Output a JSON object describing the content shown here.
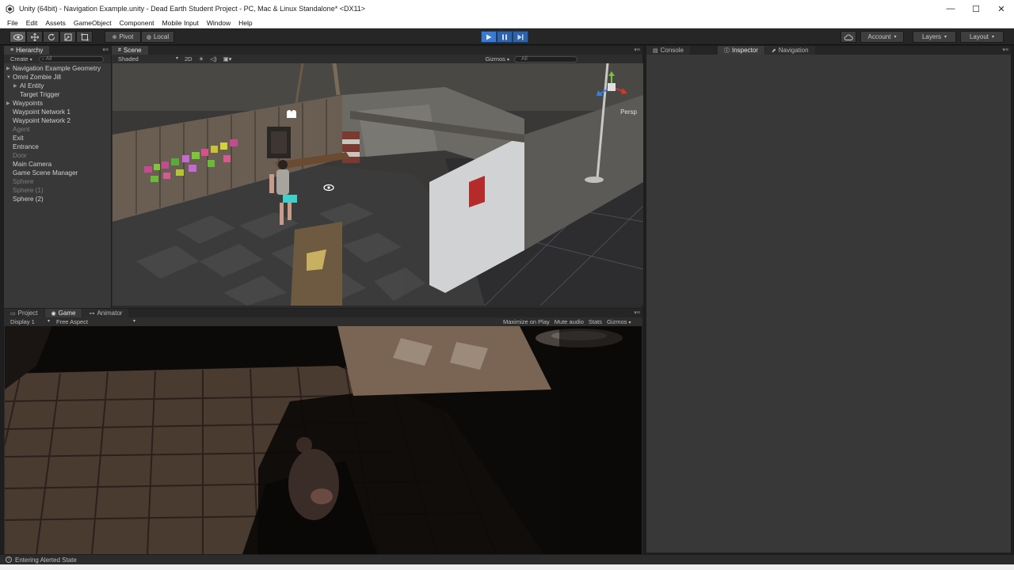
{
  "window": {
    "title": "Unity (64bit) - Navigation Example.unity - Dead Earth Student Project - PC, Mac & Linux Standalone* <DX11>",
    "minimize": "—",
    "maximize": "☐",
    "close": "✕"
  },
  "menu": [
    "File",
    "Edit",
    "Assets",
    "GameObject",
    "Component",
    "Mobile Input",
    "Window",
    "Help"
  ],
  "toolbar": {
    "pivot": "Pivot",
    "local": "Local",
    "account": "Account",
    "layers": "Layers",
    "layout": "Layout"
  },
  "hierarchy": {
    "tab": "Hierarchy",
    "create": "Create",
    "search_placeholder": "All",
    "items": [
      {
        "label": "Navigation Example Geometry",
        "indent": 0,
        "arrow": true,
        "dim": false
      },
      {
        "label": "Omni Zombie Jill",
        "indent": 0,
        "arrow": true,
        "expanded": true,
        "dim": false
      },
      {
        "label": "AI Entity",
        "indent": 1,
        "arrow": true,
        "dim": false
      },
      {
        "label": "Target Trigger",
        "indent": 1,
        "arrow": false,
        "dim": false
      },
      {
        "label": "Waypoints",
        "indent": 0,
        "arrow": true,
        "dim": false
      },
      {
        "label": "Waypoint Network 1",
        "indent": 0,
        "arrow": false,
        "dim": false
      },
      {
        "label": "Waypoint Network 2",
        "indent": 0,
        "arrow": false,
        "dim": false
      },
      {
        "label": "Agent",
        "indent": 0,
        "arrow": false,
        "dim": true
      },
      {
        "label": "Exit",
        "indent": 0,
        "arrow": false,
        "dim": false
      },
      {
        "label": "Entrance",
        "indent": 0,
        "arrow": false,
        "dim": false
      },
      {
        "label": "Door",
        "indent": 0,
        "arrow": false,
        "dim": true
      },
      {
        "label": "Main Camera",
        "indent": 0,
        "arrow": false,
        "dim": false
      },
      {
        "label": "Game Scene Manager",
        "indent": 0,
        "arrow": false,
        "dim": false
      },
      {
        "label": "Sphere",
        "indent": 0,
        "arrow": false,
        "dim": true
      },
      {
        "label": "Sphere (1)",
        "indent": 0,
        "arrow": false,
        "dim": true
      },
      {
        "label": "Sphere (2)",
        "indent": 0,
        "arrow": false,
        "dim": false
      }
    ]
  },
  "scene": {
    "tab": "Scene",
    "shading": "Shaded",
    "mode2d": "2D",
    "gizmos": "Gizmos",
    "search_placeholder": "All",
    "persp": "Persp"
  },
  "game": {
    "tabs": [
      "Project",
      "Game",
      "Animator"
    ],
    "display": "Display 1",
    "aspect": "Free Aspect",
    "maximize_on_play": "Maximize on Play",
    "mute_audio": "Mute audio",
    "stats": "Stats",
    "gizmos": "Gizmos"
  },
  "right_panel": {
    "tabs": [
      "Console",
      "Inspector",
      "Navigation"
    ]
  },
  "status": {
    "message": "Entering Alerted State"
  },
  "colors": {
    "play_active": "#3c7ad0",
    "panel_bg": "#383838",
    "dark_bg": "#1e1e1e"
  }
}
